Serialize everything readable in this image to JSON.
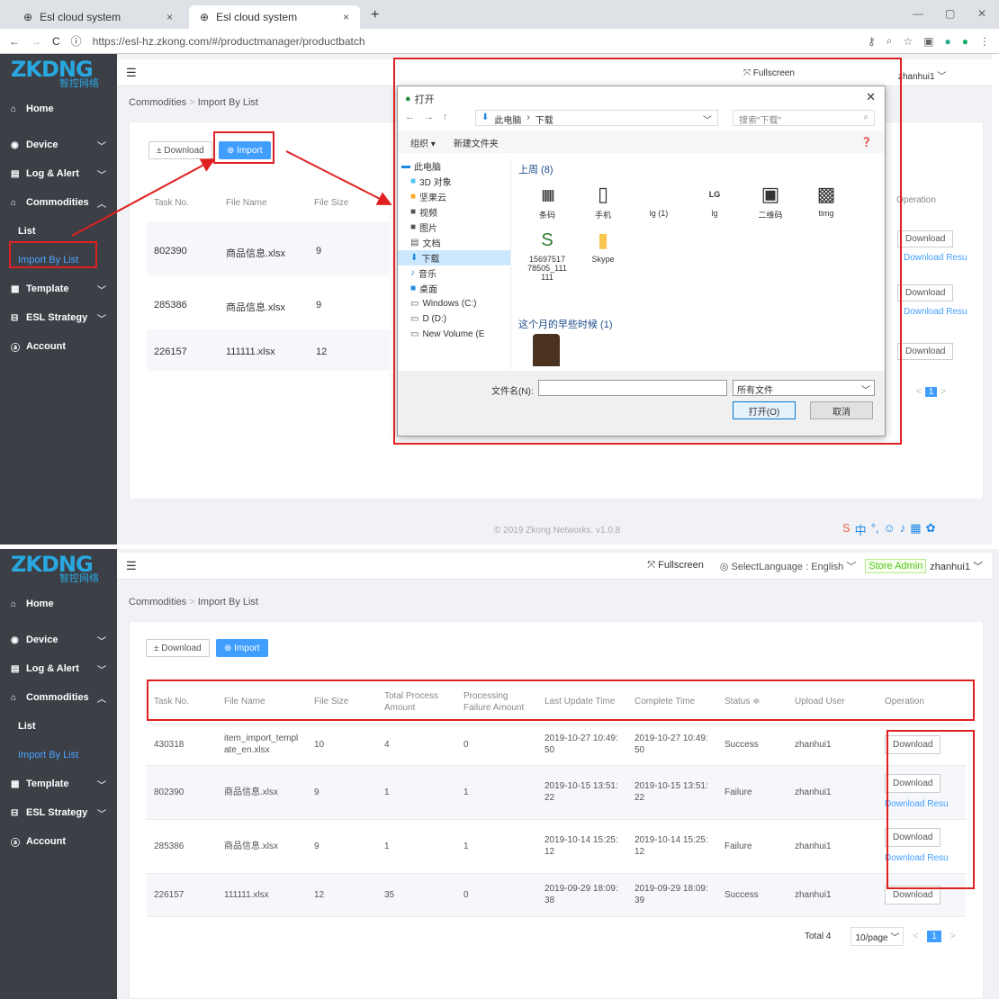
{
  "browser": {
    "tabs": [
      {
        "title": "Esl cloud system"
      },
      {
        "title": "Esl cloud system"
      }
    ],
    "url": "https://esl-hz.zkong.com/#/productmanager/productbatch",
    "new_tab": "+",
    "tab_close": "×",
    "win_min": "—",
    "win_max": "▢",
    "win_close": "✕"
  },
  "app": {
    "logo": "ZKDNG",
    "logo_sub": "智控网络",
    "menu_toggle": "☰",
    "fullscreen": "Fullscreen",
    "language": "SelectLanguage : English",
    "role": "Store Admin",
    "user": "zhanhui1",
    "breadcrumb": [
      "Commodities",
      "Import By List"
    ],
    "nav": [
      {
        "label": "Home"
      },
      {
        "label": "Device"
      },
      {
        "label": "Log & Alert"
      },
      {
        "label": "Commodities"
      },
      {
        "label": "List"
      },
      {
        "label": "Import By List"
      },
      {
        "label": "Template"
      },
      {
        "label": "ESL Strategy"
      },
      {
        "label": "Account"
      }
    ],
    "buttons": {
      "download": "± Download",
      "import": "⊕ Import"
    },
    "footer": "© 2019 Zkong Networks. v1.0.8"
  },
  "table": {
    "headers": [
      "Task No.",
      "File Name",
      "File Size",
      "Total Process Amount",
      "Processing Failure Amount",
      "Last Update Time",
      "Complete Time",
      "Status ≑",
      "Upload User",
      "Operation"
    ],
    "rows": [
      {
        "task": "430318",
        "file": "item_import_template_en.xlsx",
        "size": "10",
        "total": "4",
        "fail": "0",
        "update": "2019-10-27 10:49:50",
        "complete": "2019-10-27 10:49:50",
        "status": "Success",
        "user": "zhanhui1",
        "op1": "Download",
        "op2": ""
      },
      {
        "task": "802390",
        "file": "商品信息.xlsx",
        "size": "9",
        "total": "1",
        "fail": "1",
        "update": "2019-10-15 13:51:22",
        "complete": "2019-10-15 13:51:22",
        "status": "Failure",
        "user": "zhanhui1",
        "op1": "Download",
        "op2": "Download Result"
      },
      {
        "task": "285386",
        "file": "商品信息.xlsx",
        "size": "9",
        "total": "1",
        "fail": "1",
        "update": "2019-10-14 15:25:12",
        "complete": "2019-10-14 15:25:12",
        "status": "Failure",
        "user": "zhanhui1",
        "op1": "Download",
        "op2": "Download Result"
      },
      {
        "task": "226157",
        "file": "111111.xlsx",
        "size": "12",
        "total": "35",
        "fail": "0",
        "update": "2019-09-29 18:09:38",
        "complete": "2019-09-29 18:09:39",
        "status": "Success",
        "user": "zhanhui1",
        "op1": "Download",
        "op2": ""
      }
    ],
    "pagination": {
      "total": "Total 4",
      "per_page": "10/page",
      "page": "1",
      "prev": "<",
      "next": ">"
    }
  },
  "dialog": {
    "title": "打开",
    "path": [
      "此电脑",
      "下载"
    ],
    "search": "搜索\"下载\"",
    "organize": "组织 ▾",
    "new_folder": "新建文件夹",
    "group_last_week": "上周 (8)",
    "group_month": "这个月的早些时候 (1)",
    "tree": [
      "此电脑",
      "3D 对象",
      "坚果云",
      "视频",
      "图片",
      "文档",
      "下载",
      "音乐",
      "桌面",
      "Windows (C:)",
      "D (D:)",
      "New Volume (E"
    ],
    "files": [
      "条码",
      "手机",
      "lg (1)",
      "lg",
      "二维码",
      "timg",
      "15697517 78505_111 111",
      "Skype"
    ],
    "filename_label": "文件名(N):",
    "filetype": "所有文件",
    "open": "打开(O)",
    "cancel": "取消"
  }
}
